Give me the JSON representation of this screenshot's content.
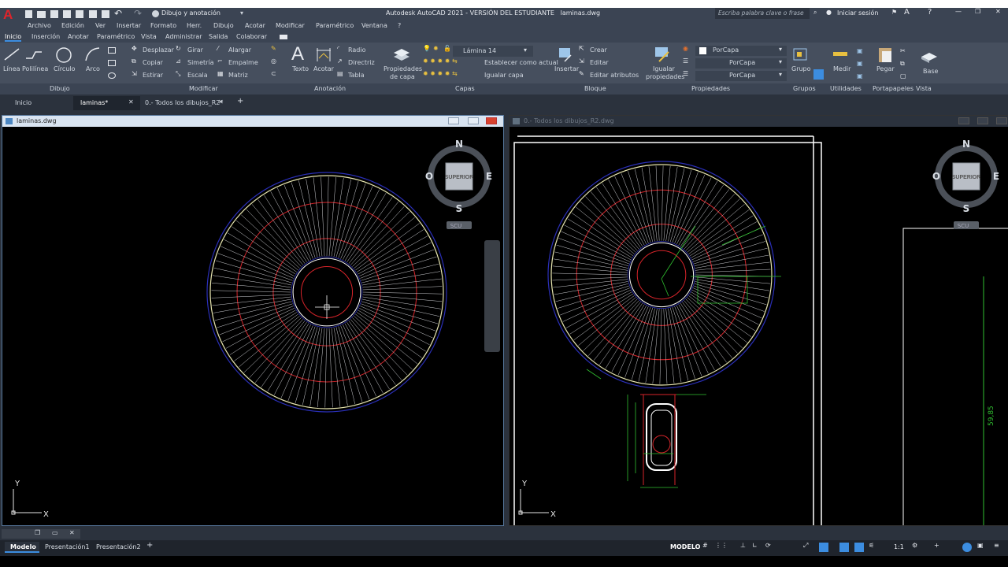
{
  "app": {
    "title": "Autodesk AutoCAD 2021 - VERSIÓN DEL ESTUDIANTE",
    "file": "laminas.dwg",
    "search_placeholder": "Escriba palabra clave o frase",
    "signin": "Iniciar sesión",
    "workspace": "Dibujo y anotación"
  },
  "menu": [
    "Archivo",
    "Edición",
    "Ver",
    "Insertar",
    "Formato",
    "Herr.",
    "Dibujo",
    "Acotar",
    "Modificar",
    "Paramétrico",
    "Ventana",
    "?"
  ],
  "ribbon_tabs": [
    "Inicio",
    "Inserción",
    "Anotar",
    "Paramétrico",
    "Vista",
    "Administrar",
    "Salida",
    "Colaborar"
  ],
  "draw": {
    "linea": "Línea",
    "polilinea": "Polilínea",
    "circulo": "Círculo",
    "arco": "Arco",
    "panel": "Dibujo"
  },
  "modify": {
    "desplazar": "Desplazar",
    "girar": "Girar",
    "alargar": "Alargar",
    "copiar": "Copiar",
    "simetria": "Simetría",
    "empalme": "Empalme",
    "estirar": "Estirar",
    "escala": "Escala",
    "matriz": "Matriz",
    "panel": "Modificar"
  },
  "annotation": {
    "texto": "Texto",
    "acotar": "Acotar",
    "radio": "Radio",
    "directriz": "Directriz",
    "tabla": "Tabla",
    "panel": "Anotación"
  },
  "layers": {
    "props": [
      "Propiedades",
      "de capa"
    ],
    "current": "Lámina 14",
    "set_current": "Establecer como actual",
    "match": "Igualar capa",
    "panel": "Capas"
  },
  "block": {
    "insertar": "Insertar",
    "crear": "Crear",
    "editar": "Editar",
    "editar_attr": "Editar atributos",
    "panel": "Bloque"
  },
  "properties": {
    "igualar": [
      "Igualar",
      "propiedades"
    ],
    "color": "PorCapa",
    "ltype": "PorCapa",
    "lweight": "PorCapa",
    "panel": "Propiedades"
  },
  "groups": {
    "grupo": "Grupo",
    "panel": "Grupos"
  },
  "utilities": {
    "medir": "Medir",
    "panel": "Utilidades"
  },
  "clipboard": {
    "pegar": "Pegar",
    "panel": "Portapapeles"
  },
  "view": {
    "base": "Base",
    "panel": "Vista"
  },
  "doc_tabs": [
    "Inicio",
    "laminas*",
    "0.- Todos los dibujos_R2*"
  ],
  "windows": {
    "left_title": "laminas.dwg",
    "right_title": "0.- Todos los dibujos_R2.dwg"
  },
  "viewcube": {
    "n": "N",
    "s": "S",
    "e": "E",
    "o": "O",
    "face": "SUPERIOR",
    "ucs": "SCU"
  },
  "axes": {
    "x": "X",
    "y": "Y"
  },
  "dims": {
    "side": "59,85"
  },
  "layout_tabs": [
    "Modelo",
    "Presentación1",
    "Presentación2"
  ],
  "status": {
    "model": "MODELO",
    "scale": "1:1"
  },
  "colors": {
    "accent": "#3c8de0",
    "circle_outer": "#e8e6b0",
    "red": "#d6242a",
    "blue": "#2a2fb8",
    "green": "#30c030",
    "white": "#ffffff"
  }
}
